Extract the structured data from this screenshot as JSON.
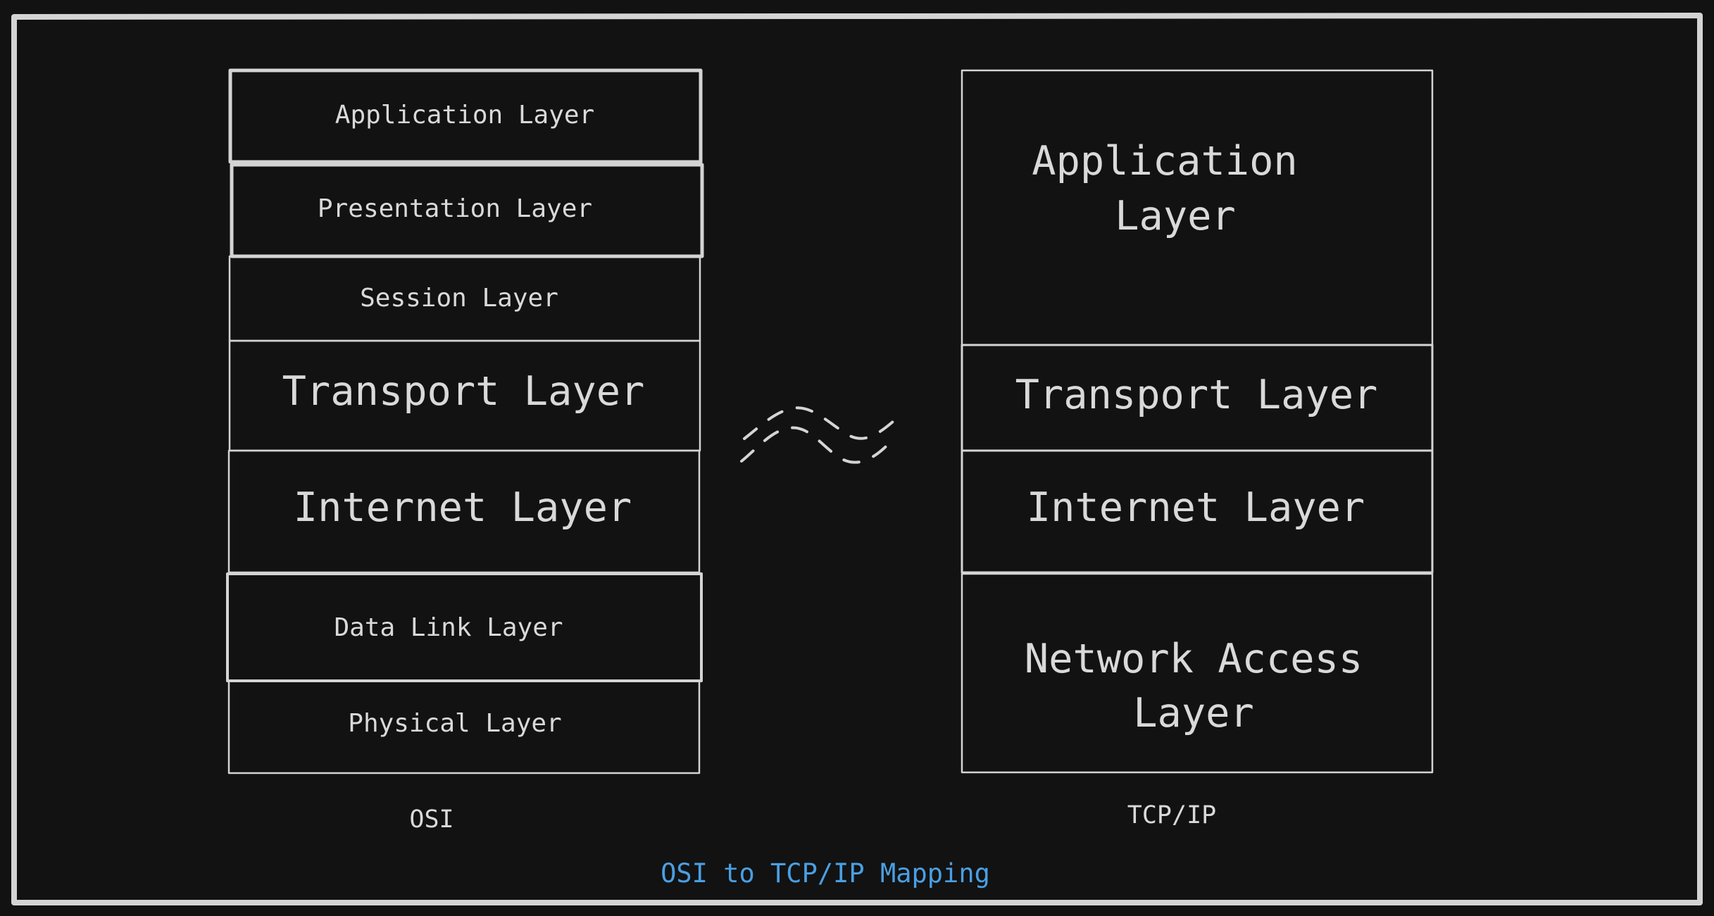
{
  "diagram": {
    "title": "OSI to TCP/IP Mapping",
    "colors": {
      "background": "#121212",
      "stroke": "#d4d4d4",
      "text": "#d9d9d9",
      "title": "#4a9fe3"
    },
    "osi": {
      "caption": "OSI",
      "layers": [
        {
          "lines": [
            "Application Layer"
          ]
        },
        {
          "lines": [
            "Presentation Layer"
          ]
        },
        {
          "lines": [
            "Session Layer"
          ]
        },
        {
          "lines": [
            "Transport Layer"
          ]
        },
        {
          "lines": [
            "Internet Layer"
          ]
        },
        {
          "lines": [
            "Data Link Layer"
          ]
        },
        {
          "lines": [
            "Physical Layer"
          ]
        }
      ]
    },
    "tcpip": {
      "caption": "TCP/IP",
      "layers": [
        {
          "lines": [
            "Application",
            "Layer"
          ]
        },
        {
          "lines": [
            "Transport Layer"
          ]
        },
        {
          "lines": [
            "Internet Layer"
          ]
        },
        {
          "lines": [
            "Network Access",
            "Layer"
          ]
        }
      ]
    },
    "connector": {
      "icon": "approximately-equal-icon",
      "meaning": "maps to"
    }
  }
}
